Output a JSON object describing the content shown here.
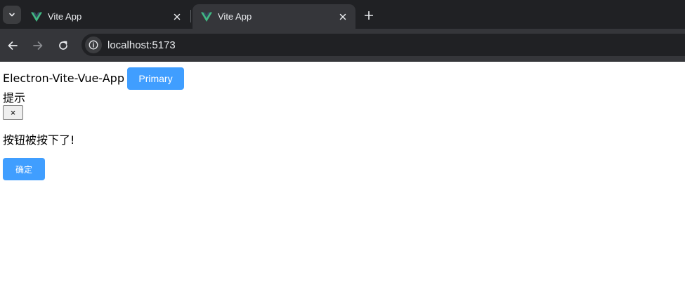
{
  "browser": {
    "tabs": [
      {
        "title": "Vite App",
        "active": false
      },
      {
        "title": "Vite App",
        "active": true
      }
    ],
    "url": "localhost:5173",
    "colors": {
      "tab_bg": "#202124",
      "toolbar_bg": "#35363a",
      "vue_green": "#41b883"
    }
  },
  "page": {
    "app_title": "Electron-Vite-Vue-App",
    "primary_button_label": "Primary",
    "dialog": {
      "title": "提示",
      "close_label": "×",
      "message": "按钮被按下了!",
      "confirm_label": "确定"
    },
    "colors": {
      "accent": "#409eff"
    }
  }
}
